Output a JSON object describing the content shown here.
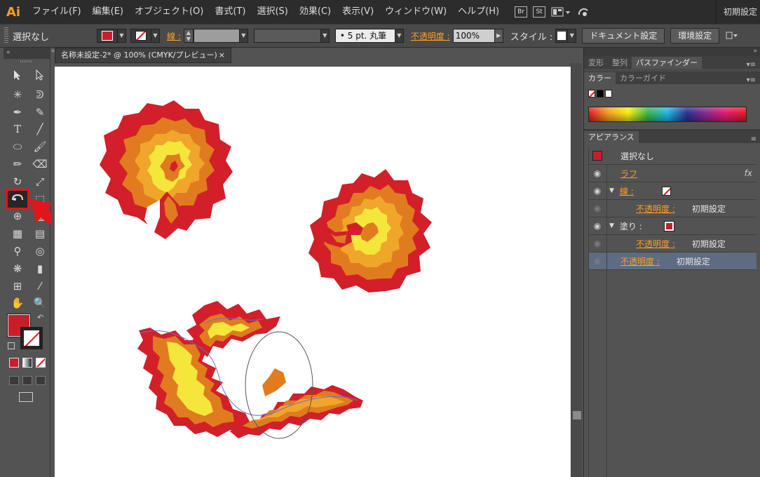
{
  "app": {
    "logo": "Ai",
    "workspace": "初期設定"
  },
  "menu": [
    "ファイル(F)",
    "編集(E)",
    "オブジェクト(O)",
    "書式(T)",
    "選択(S)",
    "効果(C)",
    "表示(V)",
    "ウィンドウ(W)",
    "ヘルプ(H)"
  ],
  "menu_badges": [
    "Br",
    "St"
  ],
  "control": {
    "selection": "選択なし",
    "stroke_label": "線 :",
    "brush": "• 5 pt. 丸筆",
    "opacity_label": "不透明度 :",
    "opacity_value": "100%",
    "style_label": "スタイル :",
    "doc_settings": "ドキュメント設定",
    "prefs": "環境設定"
  },
  "document": {
    "tab_title": "名称未設定-2* @ 100% (CMYK/プレビュー)",
    "close": "×"
  },
  "panels": {
    "top_tabs": [
      "変形",
      "整列",
      "パスファインダー"
    ],
    "color_tabs": [
      "カラー",
      "カラーガイド"
    ],
    "appearance_tab": "アピアランス",
    "appearance": {
      "header": "選択なし",
      "brush_name": "ラフ",
      "fx": "fx",
      "stroke_label": "線 :",
      "stroke_opacity_label": "不透明度 :",
      "stroke_opacity_value": "初期設定",
      "fill_label": "塗り :",
      "fill_opacity_label": "不透明度 :",
      "fill_opacity_value": "初期設定",
      "opacity_label": "不透明度 :",
      "opacity_value": "初期設定"
    }
  },
  "colors": {
    "accent_red": "#e4141b",
    "fill_red": "#c81e2b",
    "orange_label": "#f79f2b",
    "flame_orange": "#e07c1f",
    "flame_yellow": "#f5e63c"
  }
}
